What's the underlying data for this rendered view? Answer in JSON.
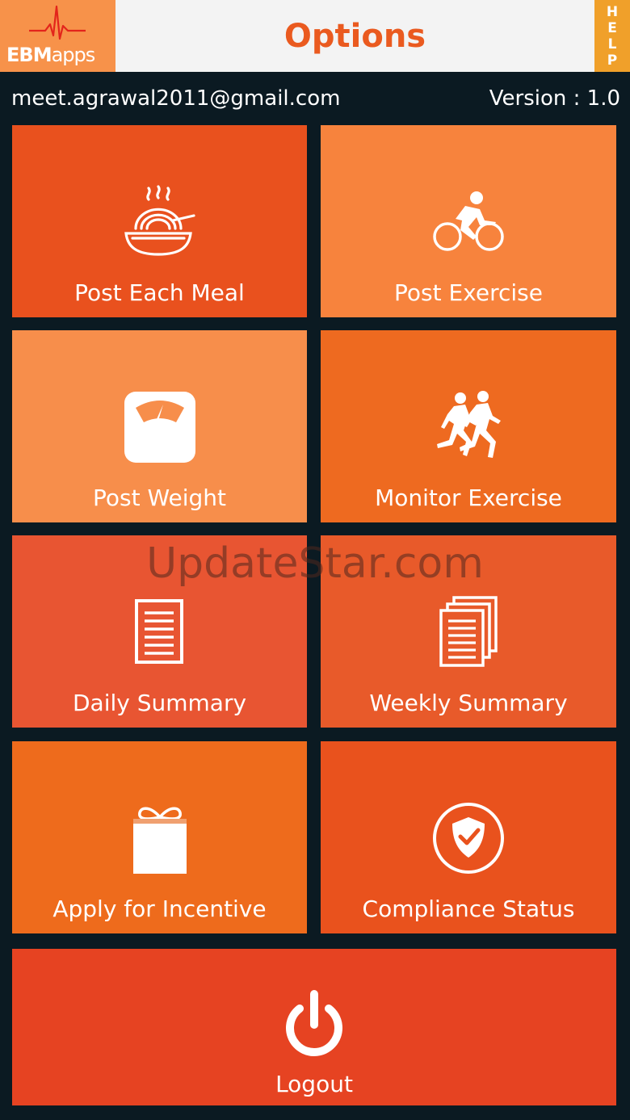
{
  "header": {
    "logo_text_bold": "EBM",
    "logo_text_light": "apps",
    "title": "Options",
    "help_letters": [
      "H",
      "E",
      "L",
      "P"
    ]
  },
  "info": {
    "email": "meet.agrawal2011@gmail.com",
    "version": "Version : 1.0"
  },
  "tiles": [
    {
      "label": "Post Each Meal",
      "icon": "noodle-bowl-icon",
      "color": "#e9511e"
    },
    {
      "label": "Post Exercise",
      "icon": "cyclist-icon",
      "color": "#f7833d"
    },
    {
      "label": "Post Weight",
      "icon": "weighing-scale-icon",
      "color": "#f78e4b"
    },
    {
      "label": "Monitor Exercise",
      "icon": "runners-icon",
      "color": "#ee6a20"
    },
    {
      "label": "Daily Summary",
      "icon": "document-icon",
      "color": "#e85532"
    },
    {
      "label": "Weekly Summary",
      "icon": "documents-stack-icon",
      "color": "#e85a2a"
    },
    {
      "label": "Apply for Incentive",
      "icon": "gift-icon",
      "color": "#ee6b1c"
    },
    {
      "label": "Compliance Status",
      "icon": "shield-check-icon",
      "color": "#e9521d"
    },
    {
      "label": "Logout",
      "icon": "power-icon",
      "color": "#e64322"
    }
  ],
  "watermark": "UpdateStar.com",
  "colors": {
    "background": "#0b1a22",
    "title": "#ea5a1f",
    "help": "#f0a02a"
  }
}
